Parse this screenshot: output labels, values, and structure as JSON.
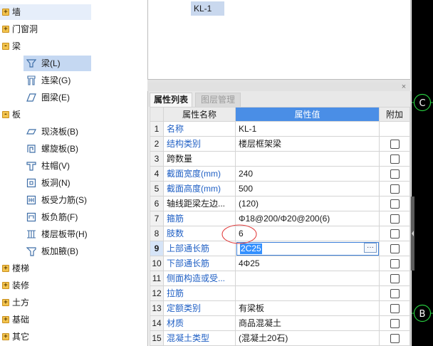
{
  "tree": {
    "items": [
      {
        "label": "墙",
        "expander": "+",
        "hovered": true
      },
      {
        "label": "门窗洞",
        "expander": "+"
      },
      {
        "label": "梁",
        "expander": "-"
      },
      {
        "label": "梁(L)",
        "selected": true
      },
      {
        "label": "连梁(G)"
      },
      {
        "label": "圈梁(E)"
      },
      {
        "label": "板",
        "expander": "-"
      },
      {
        "label": "现浇板(B)"
      },
      {
        "label": "螺旋板(B)"
      },
      {
        "label": "柱帽(V)"
      },
      {
        "label": "板洞(N)"
      },
      {
        "label": "板受力筋(S)"
      },
      {
        "label": "板负筋(F)"
      },
      {
        "label": "楼层板带(H)"
      },
      {
        "label": "板加腋(B)"
      },
      {
        "label": "楼梯",
        "expander": "+"
      },
      {
        "label": "装修",
        "expander": "+"
      },
      {
        "label": "土方",
        "expander": "+"
      },
      {
        "label": "基础",
        "expander": "+"
      },
      {
        "label": "其它",
        "expander": "+"
      }
    ]
  },
  "component_list": {
    "selected_item": "KL-1"
  },
  "panel": {
    "close_label": "×",
    "tabs": [
      {
        "label": "属性列表",
        "active": true
      },
      {
        "label": "图层管理",
        "active": false
      }
    ],
    "headers": {
      "name": "属性名称",
      "value": "属性值",
      "attach": "附加"
    },
    "rows": [
      {
        "no": "1",
        "name": "名称",
        "value": "KL-1"
      },
      {
        "no": "2",
        "name": "结构类别",
        "value": "楼层框架梁",
        "checked": false
      },
      {
        "no": "3",
        "name": "跨数量",
        "value": "",
        "checked": false
      },
      {
        "no": "4",
        "name": "截面宽度(mm)",
        "value": "240",
        "checked": false
      },
      {
        "no": "5",
        "name": "截面高度(mm)",
        "value": "500",
        "checked": false
      },
      {
        "no": "6",
        "name": "轴线距梁左边...",
        "value": "(120)",
        "checked": false
      },
      {
        "no": "7",
        "name": "箍筋",
        "value": "Φ18@200/Φ20@200(6)",
        "checked": false
      },
      {
        "no": "8",
        "name": "肢数",
        "value": "6",
        "checked": false
      },
      {
        "no": "9",
        "name": "上部通长筋",
        "value": "2C25",
        "editing": true,
        "checked": false
      },
      {
        "no": "10",
        "name": "下部通长筋",
        "value": "4Φ25",
        "checked": false
      },
      {
        "no": "11",
        "name": "侧面构造或受...",
        "value": "",
        "checked": false
      },
      {
        "no": "12",
        "name": "拉筋",
        "value": "",
        "checked": false
      },
      {
        "no": "13",
        "name": "定额类别",
        "value": "有梁板",
        "checked": false
      },
      {
        "no": "14",
        "name": "材质",
        "value": "商品混凝土",
        "checked": false
      },
      {
        "no": "15",
        "name": "混凝土类型",
        "value": "(混凝土20石)",
        "checked": false
      }
    ],
    "editor_button": "···"
  },
  "grid_axes": [
    {
      "label": "C"
    },
    {
      "label": "B"
    }
  ],
  "colors": {
    "accent": "#4a8ee6",
    "link": "#1f5fc4",
    "selection": "#c5d8f2",
    "hover": "#e6eefa",
    "axis": "#27c93f",
    "annotation": "#e23b3b"
  }
}
